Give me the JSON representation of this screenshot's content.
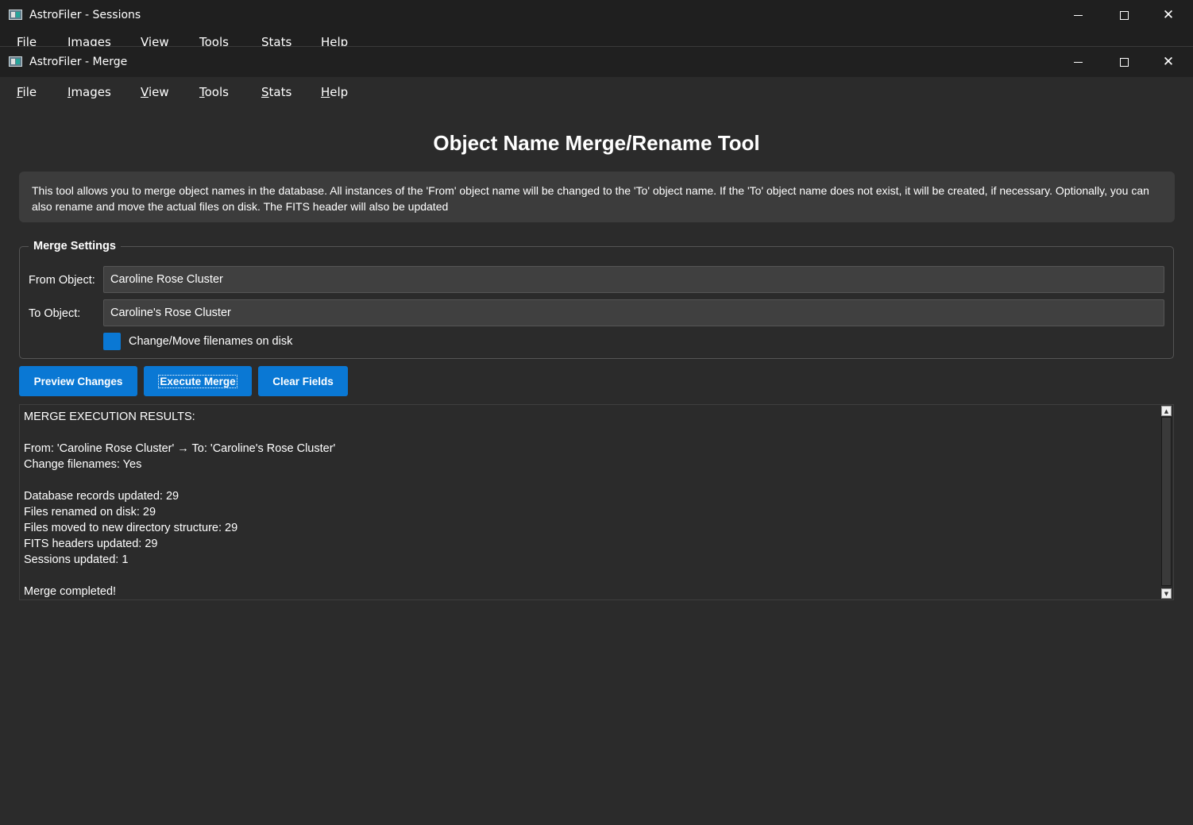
{
  "background_window": {
    "title": "AstroFiler - Sessions",
    "menu": [
      "File",
      "Images",
      "View",
      "Tools",
      "Stats",
      "Help"
    ]
  },
  "window": {
    "title": "AstroFiler - Merge",
    "controls": {
      "minimize": "minimize-icon",
      "maximize": "maximize-icon",
      "close": "close-icon"
    }
  },
  "menu": [
    {
      "label": "File",
      "mnemonic": "F",
      "rest": "ile"
    },
    {
      "label": "Images",
      "mnemonic": "I",
      "rest": "mages"
    },
    {
      "label": "View",
      "mnemonic": "V",
      "rest": "iew"
    },
    {
      "label": "Tools",
      "mnemonic": "T",
      "rest": "ools"
    },
    {
      "label": "Stats",
      "mnemonic": "S",
      "rest": "tats"
    },
    {
      "label": "Help",
      "mnemonic": "H",
      "rest": "elp"
    }
  ],
  "page_title": "Object Name Merge/Rename Tool",
  "info_text": "This tool allows you to merge object names in the database. All instances of the 'From' object name will be changed to the 'To' object name. If the 'To' object name does not exist, it will be created, if necessary. Optionally, you can also rename and move the actual files on disk. The FITS header will also be updated",
  "merge_settings": {
    "title": "Merge Settings",
    "from_label": "From Object:",
    "from_value": "Caroline Rose Cluster",
    "to_label": "To Object:",
    "to_value": "Caroline's Rose Cluster",
    "checkbox_label": "Change/Move filenames on disk",
    "checkbox_checked": true
  },
  "buttons": {
    "preview": "Preview Changes",
    "execute": "Execute Merge",
    "clear": "Clear Fields"
  },
  "output_lines": [
    "MERGE EXECUTION RESULTS:",
    "",
    "From: 'Caroline Rose Cluster' → To: 'Caroline's Rose Cluster'",
    "Change filenames: Yes",
    "",
    "Database records updated: 29",
    "Files renamed on disk: 29",
    "Files moved to new directory structure: 29",
    "FITS headers updated: 29",
    "Sessions updated: 1",
    "",
    "Merge completed!"
  ],
  "colors": {
    "accent": "#0a78d4",
    "background": "#2b2b2b",
    "panel": "#3c3c3c",
    "input": "#404040"
  }
}
